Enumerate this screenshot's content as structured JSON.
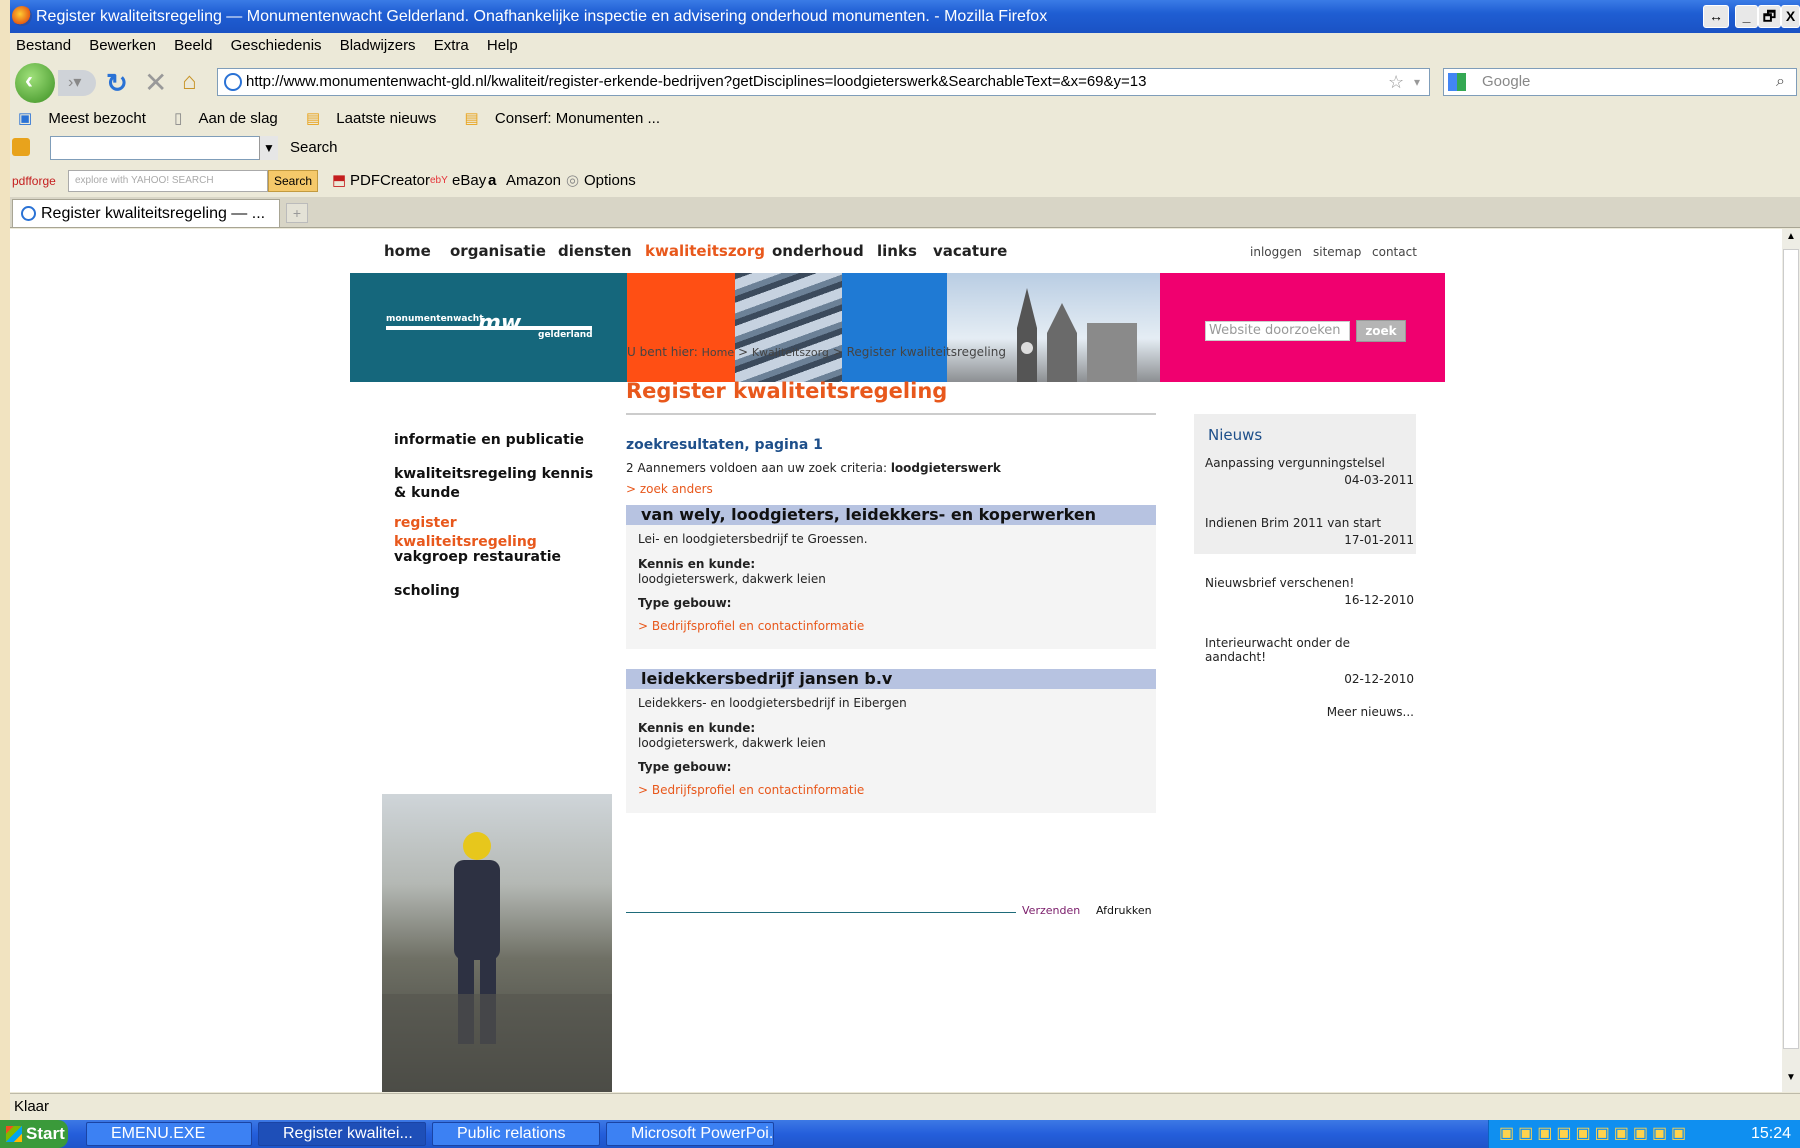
{
  "window": {
    "title": "Register kwaliteitsregeling — Monumentenwacht Gelderland. Onafhankelijke inspectie en advisering onderhoud monumenten. - Mozilla Firefox",
    "buttons": [
      "↔",
      "_",
      "🗗",
      "X"
    ]
  },
  "menu": [
    "Bestand",
    "Bewerken",
    "Beeld",
    "Geschiedenis",
    "Bladwijzers",
    "Extra",
    "Help"
  ],
  "url": "http://www.monumentenwacht-gld.nl/kwaliteit/register-erkende-bedrijven?getDisciplines=loodgieterswerk&SearchableText=&x=69&y=13",
  "search_engine_placeholder": "Google",
  "bookmarks": [
    "Meest bezocht",
    "Aan de slag",
    "Laatste nieuws",
    "Conserf: Monumenten ..."
  ],
  "toolbar3": {
    "search_label": "Search"
  },
  "toolbar4": {
    "brand": "pdfforge",
    "yahoo_placeholder": "explore with YAHOO! SEARCH",
    "search_btn": "Search",
    "items": [
      "PDFCreator",
      "eBay",
      "Amazon",
      "Options"
    ]
  },
  "tab": {
    "label": "Register kwaliteitsregeling — ..."
  },
  "status_text": "Klaar",
  "taskbar": {
    "start": "Start",
    "items": [
      "EMENU.EXE",
      "Register kwalitei...",
      "Public relations",
      "Microsoft PowerPoi..."
    ],
    "clock": "15:24"
  },
  "site": {
    "topnav": [
      "home",
      "organisatie",
      "diensten",
      "kwaliteitszorg",
      "onderhoud",
      "links",
      "vacature"
    ],
    "util": [
      "inloggen",
      "sitemap",
      "contact"
    ],
    "logo_left": "monumentenwacht",
    "logo_mark": "mw",
    "logo_right": "gelderland",
    "search_placeholder": "Website doorzoeken",
    "search_button": "zoek",
    "crumb": {
      "prefix": "U bent hier:",
      "home": "Home",
      "sep": ">",
      "level1": "Kwaliteitszorg",
      "current": "Register kwaliteitsregeling"
    },
    "title": "Register kwaliteitsregeling",
    "leftnav": [
      "informatie en publicatie",
      "kwaliteitsregeling kennis & kunde",
      "register kwaliteitsregeling",
      "vakgroep restauratie",
      "scholing"
    ],
    "results_heading": "zoekresultaten, pagina 1",
    "results_count_text": "2 Aannemers voldoen aan uw zoek criteria:",
    "results_term": "loodgieterswerk",
    "search_other": "> zoek anders",
    "results": [
      {
        "name": "van wely, loodgieters, leidekkers- en koperwerken",
        "desc": "Lei- en loodgietersbedrijf te Groessen.",
        "kennis_label": "Kennis en kunde:",
        "kennis": "loodgieterswerk, dakwerk leien",
        "type_label": "Type gebouw:",
        "link": "> Bedrijfsprofiel en contactinformatie"
      },
      {
        "name": "leidekkersbedrijf jansen b.v",
        "desc": "Leidekkers- en loodgietersbedrijf in Eibergen",
        "kennis_label": "Kennis en kunde:",
        "kennis": "loodgieterswerk, dakwerk leien",
        "type_label": "Type gebouw:",
        "link": "> Bedrijfsprofiel en contactinformatie"
      }
    ],
    "footer_links": [
      "Verzenden",
      "Afdrukken"
    ],
    "news": {
      "title": "Nieuws",
      "items": [
        {
          "text": "Aanpassing vergunningstelsel",
          "date": "04-03-2011"
        },
        {
          "text": "Indienen Brim 2011 van start",
          "date": "17-01-2011"
        },
        {
          "text": "Nieuwsbrief verschenen!",
          "date": "16-12-2010"
        },
        {
          "text": "Interieurwacht onder de aandacht!",
          "date": "02-12-2010"
        }
      ],
      "more": "Meer nieuws..."
    }
  }
}
